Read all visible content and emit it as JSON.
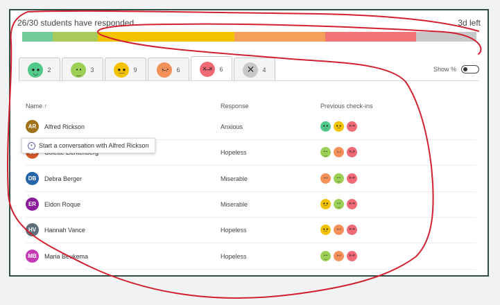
{
  "header": {
    "responded": "26/30 students have responded",
    "time_left": "3d left"
  },
  "progress_segments": [
    {
      "label": "happy",
      "fraction": 0.0667,
      "color": "#72cc9a"
    },
    {
      "label": "calm",
      "fraction": 0.1,
      "color": "#a9c95a"
    },
    {
      "label": "neutral",
      "fraction": 0.3,
      "color": "#f3c200"
    },
    {
      "label": "sad",
      "fraction": 0.2,
      "color": "#f4a05b"
    },
    {
      "label": "angry",
      "fraction": 0.2,
      "color": "#f47575"
    },
    {
      "label": "no-response",
      "fraction": 0.1333,
      "color": "#c8c8c8"
    }
  ],
  "tabs": [
    {
      "count": "2",
      "face": "happy",
      "color": "#51c98a"
    },
    {
      "count": "3",
      "face": "calm",
      "color": "#9bcf55"
    },
    {
      "count": "9",
      "face": "neutral",
      "color": "#f3c200"
    },
    {
      "count": "6",
      "face": "sad",
      "color": "#f4915a"
    },
    {
      "count": "6",
      "face": "angry",
      "color": "#f06a76"
    },
    {
      "count": "4",
      "face": "x-icon",
      "color": "#c8c8c8"
    }
  ],
  "show_percent": {
    "label": "Show %",
    "on": false
  },
  "columns": {
    "name": "Name ↑",
    "response": "Response",
    "previous": "Previous check-ins"
  },
  "rows": [
    {
      "initials": "AR",
      "name": "Alfred Rickson",
      "avatar_color": "#a0721a",
      "response": "Anxious",
      "prev": [
        "happy",
        "neutral",
        "angry"
      ]
    },
    {
      "initials": "CL",
      "name": "Colette Lichtenberg",
      "avatar_color": "#d45a2a",
      "response": "Hopeless",
      "prev": [
        "calm",
        "sad",
        "angry"
      ]
    },
    {
      "initials": "DB",
      "name": "Debra Berger",
      "avatar_color": "#2564a8",
      "response": "Miserable",
      "prev": [
        "sad",
        "calm",
        "angry"
      ]
    },
    {
      "initials": "ER",
      "name": "Eldon Roque",
      "avatar_color": "#8a1b9a",
      "response": "Miserable",
      "prev": [
        "neutral",
        "calm",
        "angry"
      ]
    },
    {
      "initials": "HV",
      "name": "Hannah Vance",
      "avatar_color": "#5f6f7a",
      "response": "Hopeless",
      "prev": [
        "neutral",
        "sad",
        "angry"
      ]
    },
    {
      "initials": "MB",
      "name": "Maria Beukema",
      "avatar_color": "#c53bb4",
      "response": "Hopeless",
      "prev": [
        "calm",
        "sad",
        "angry"
      ]
    }
  ],
  "tooltip": {
    "text": "Start a conversation with Alfred Rickson",
    "icon": "chat-icon"
  },
  "face_colors": {
    "happy": "#51c98a",
    "calm": "#9bcf55",
    "neutral": "#f3c200",
    "sad": "#f4915a",
    "angry": "#f06a76"
  },
  "annotation_color": "#d0202e"
}
